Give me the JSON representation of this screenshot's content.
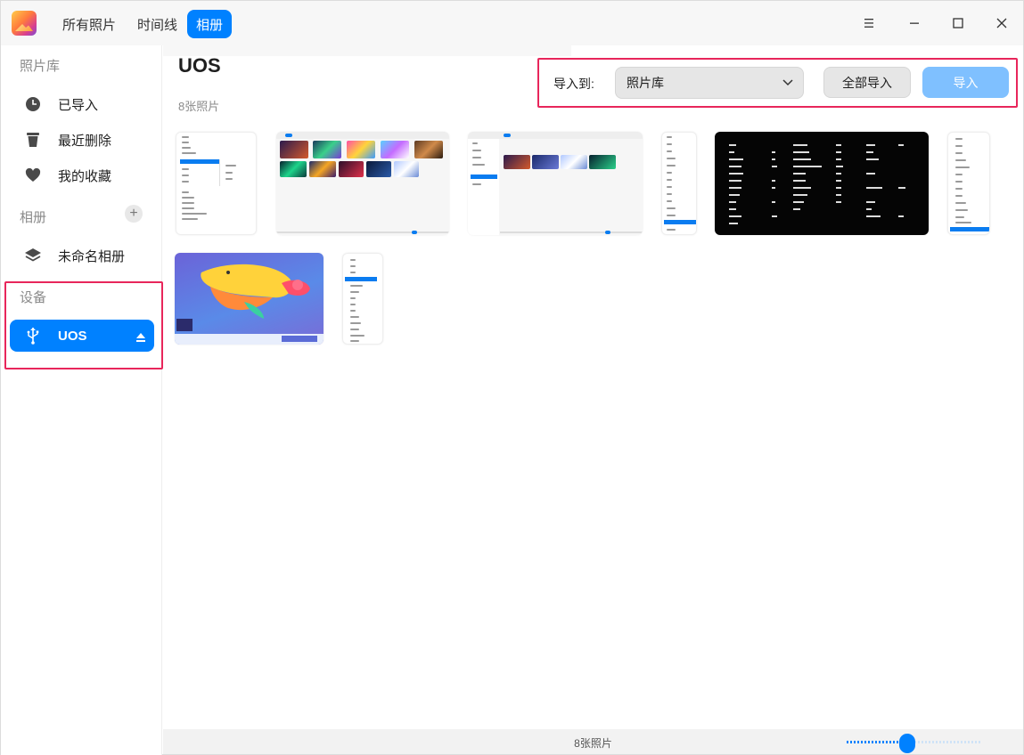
{
  "titlebar": {
    "tabs": [
      {
        "label": "所有照片",
        "active": false
      },
      {
        "label": "时间线",
        "active": false
      },
      {
        "label": "相册",
        "active": true
      }
    ],
    "menu_icon": "hamburger-icon",
    "minimize_icon": "minimize-icon",
    "maximize_icon": "maximize-icon",
    "close_icon": "close-icon"
  },
  "sidebar": {
    "library_title": "照片库",
    "library_items": [
      {
        "label": "已导入",
        "icon": "clock-icon"
      },
      {
        "label": "最近删除",
        "icon": "trash-icon"
      },
      {
        "label": "我的收藏",
        "icon": "heart-icon"
      }
    ],
    "albums_title": "相册",
    "add_album_icon": "plus-icon",
    "album_items": [
      {
        "label": "未命名相册",
        "icon": "layers-icon"
      }
    ],
    "devices_title": "设备",
    "device_items": [
      {
        "label": "UOS",
        "icon": "usb-icon",
        "eject_icon": "eject-icon",
        "active": true
      }
    ]
  },
  "main": {
    "title": "UOS",
    "photo_count": "8张照片",
    "import_to_label": "导入到:",
    "import_target": "照片库",
    "import_all_label": "全部导入",
    "import_label": "导入"
  },
  "statusbar": {
    "photo_count": "8张照片",
    "zoom_level": 0.45
  },
  "colors": {
    "accent": "#0081ff",
    "highlight_box": "#e8265b"
  }
}
